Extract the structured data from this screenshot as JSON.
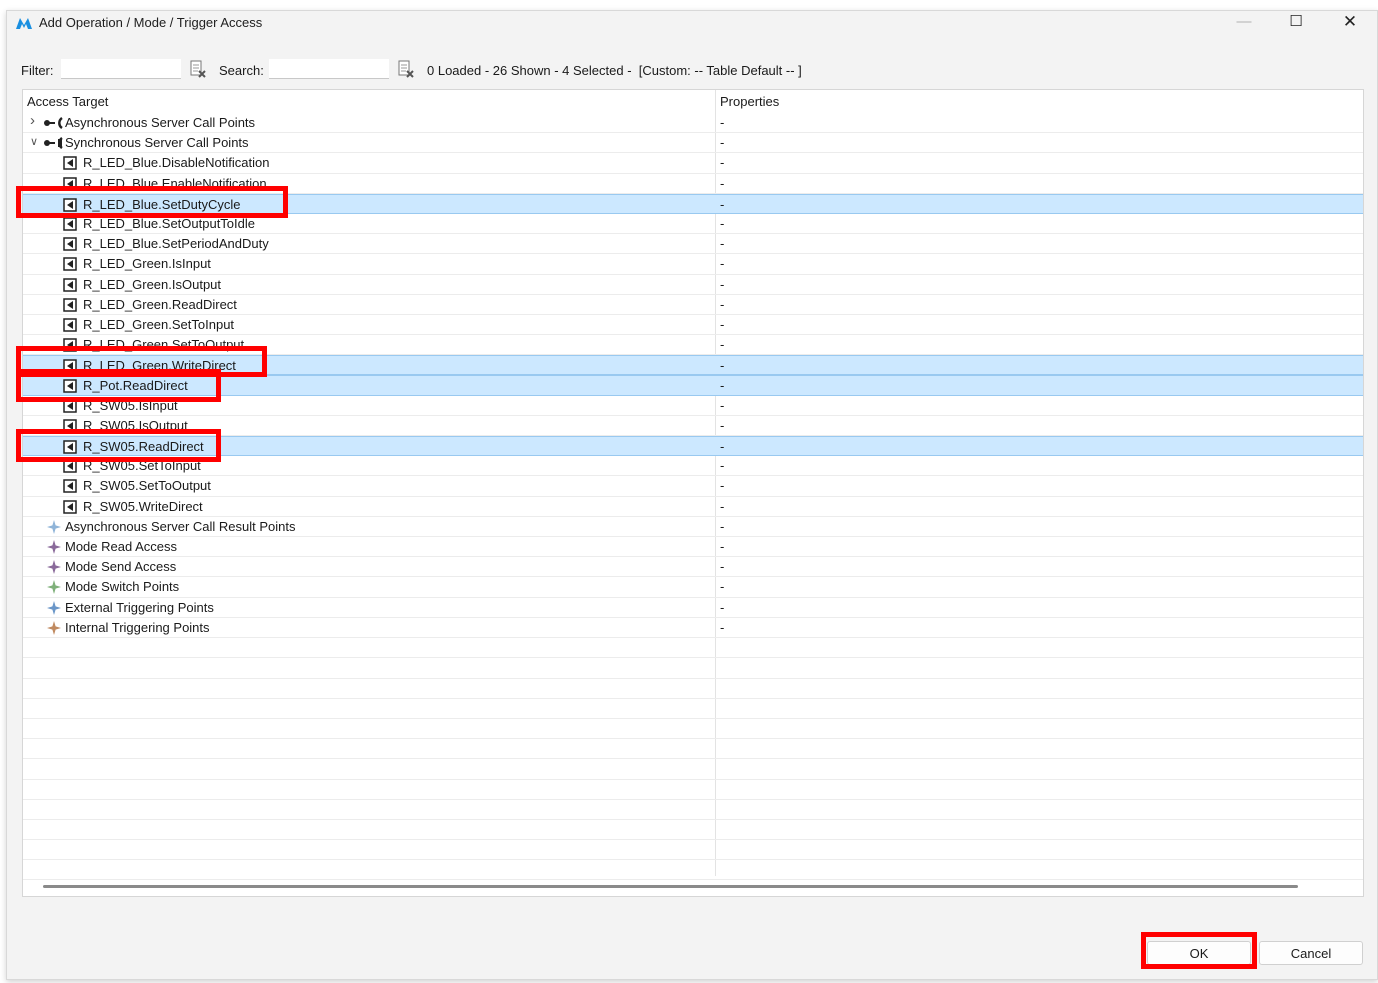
{
  "window": {
    "title": "Add Operation / Mode / Trigger Access",
    "minimize_glyph": "—",
    "maximize_glyph": "☐",
    "close_glyph": "✕"
  },
  "toolbar": {
    "filter_label": "Filter:",
    "filter_value": "",
    "search_label": "Search:",
    "search_value": "",
    "status": "0 Loaded - 26 Shown - 4 Selected -  [Custom: -- Table Default -- ]"
  },
  "table": {
    "columns": [
      "Access Target",
      "Properties"
    ],
    "rows": [
      {
        "label": "Asynchronous Server Call Points",
        "prop": "-",
        "icon": "async-server-call-icon",
        "chevron": "collapsed",
        "level": 0,
        "selected": false
      },
      {
        "label": "Synchronous Server Call Points",
        "prop": "-",
        "icon": "sync-server-call-icon",
        "chevron": "expanded",
        "level": 0,
        "selected": false
      },
      {
        "label": "R_LED_Blue.DisableNotification",
        "prop": "-",
        "icon": "operation-icon",
        "level": 1,
        "selected": false
      },
      {
        "label": "R_LED_Blue.EnableNotification",
        "prop": "-",
        "icon": "operation-icon",
        "level": 1,
        "selected": false
      },
      {
        "label": "R_LED_Blue.SetDutyCycle",
        "prop": "-",
        "icon": "operation-icon",
        "level": 1,
        "selected": true
      },
      {
        "label": "R_LED_Blue.SetOutputToIdle",
        "prop": "-",
        "icon": "operation-icon",
        "level": 1,
        "selected": false
      },
      {
        "label": "R_LED_Blue.SetPeriodAndDuty",
        "prop": "-",
        "icon": "operation-icon",
        "level": 1,
        "selected": false
      },
      {
        "label": "R_LED_Green.IsInput",
        "prop": "-",
        "icon": "operation-icon",
        "level": 1,
        "selected": false
      },
      {
        "label": "R_LED_Green.IsOutput",
        "prop": "-",
        "icon": "operation-icon",
        "level": 1,
        "selected": false
      },
      {
        "label": "R_LED_Green.ReadDirect",
        "prop": "-",
        "icon": "operation-icon",
        "level": 1,
        "selected": false
      },
      {
        "label": "R_LED_Green.SetToInput",
        "prop": "-",
        "icon": "operation-icon",
        "level": 1,
        "selected": false
      },
      {
        "label": "R_LED_Green.SetToOutput",
        "prop": "-",
        "icon": "operation-icon",
        "level": 1,
        "selected": false
      },
      {
        "label": "R_LED_Green.WriteDirect",
        "prop": "-",
        "icon": "operation-icon",
        "level": 1,
        "selected": true
      },
      {
        "label": "R_Pot.ReadDirect",
        "prop": "-",
        "icon": "operation-icon",
        "level": 1,
        "selected": true
      },
      {
        "label": "R_SW05.IsInput",
        "prop": "-",
        "icon": "operation-icon",
        "level": 1,
        "selected": false
      },
      {
        "label": "R_SW05.IsOutput",
        "prop": "-",
        "icon": "operation-icon",
        "level": 1,
        "selected": false
      },
      {
        "label": "R_SW05.ReadDirect",
        "prop": "-",
        "icon": "operation-icon",
        "level": 1,
        "selected": true
      },
      {
        "label": "R_SW05.SetToInput",
        "prop": "-",
        "icon": "operation-icon",
        "level": 1,
        "selected": false
      },
      {
        "label": "R_SW05.SetToOutput",
        "prop": "-",
        "icon": "operation-icon",
        "level": 1,
        "selected": false
      },
      {
        "label": "R_SW05.WriteDirect",
        "prop": "-",
        "icon": "operation-icon",
        "level": 1,
        "selected": false
      },
      {
        "label": "Asynchronous Server Call Result Points",
        "prop": "-",
        "icon": "async-result-point-icon",
        "level": 0,
        "selected": false,
        "color": "#8fb4d8"
      },
      {
        "label": "Mode Read Access",
        "prop": "-",
        "icon": "mode-read-icon",
        "level": 0,
        "selected": false,
        "color": "#8a6a9a"
      },
      {
        "label": "Mode Send Access",
        "prop": "-",
        "icon": "mode-send-icon",
        "level": 0,
        "selected": false,
        "color": "#8a6a9a"
      },
      {
        "label": "Mode Switch Points",
        "prop": "-",
        "icon": "mode-switch-icon",
        "level": 0,
        "selected": false,
        "color": "#7fb07a"
      },
      {
        "label": "External Triggering Points",
        "prop": "-",
        "icon": "external-trigger-icon",
        "level": 0,
        "selected": false,
        "color": "#6a96c8"
      },
      {
        "label": "Internal Triggering Points",
        "prop": "-",
        "icon": "internal-trigger-icon",
        "level": 0,
        "selected": false,
        "color": "#c08a60"
      }
    ]
  },
  "buttons": {
    "ok": "OK",
    "cancel": "Cancel"
  },
  "colors": {
    "selection": "#cce8ff",
    "highlight": "#ff0000",
    "app_icon": "#1a8fe0"
  }
}
